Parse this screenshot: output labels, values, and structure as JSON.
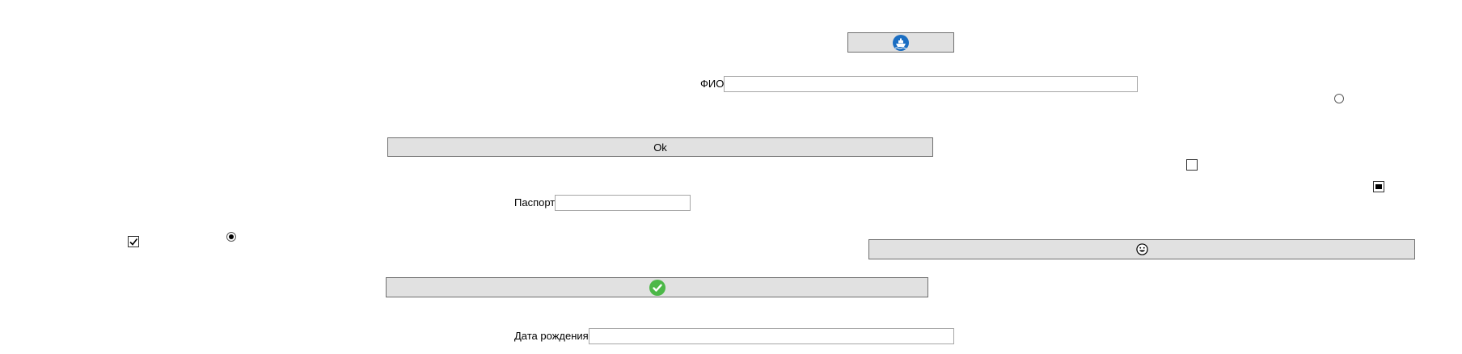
{
  "buttons": {
    "ship_button": {
      "icon": "ship-icon",
      "accent": "#1b6ec2"
    },
    "ok_button": {
      "label": "Ok"
    },
    "smiley_button": {
      "icon": "grinning-face-icon"
    },
    "check_button": {
      "icon": "check-circle-icon",
      "accent": "#4cb848"
    }
  },
  "form": {
    "fio": {
      "label": "ФИО",
      "value": ""
    },
    "passport": {
      "label": "Паспорт",
      "value": ""
    },
    "birth_date": {
      "label": "Дата рождения",
      "value": ""
    }
  },
  "controls": {
    "radio_top_right": {
      "checked": false
    },
    "radio_left": {
      "checked": true
    },
    "checkbox_empty": {
      "checked": false
    },
    "checkbox_indeterminate": {
      "state": "indeterminate"
    },
    "checkbox_checked": {
      "checked": true
    }
  }
}
